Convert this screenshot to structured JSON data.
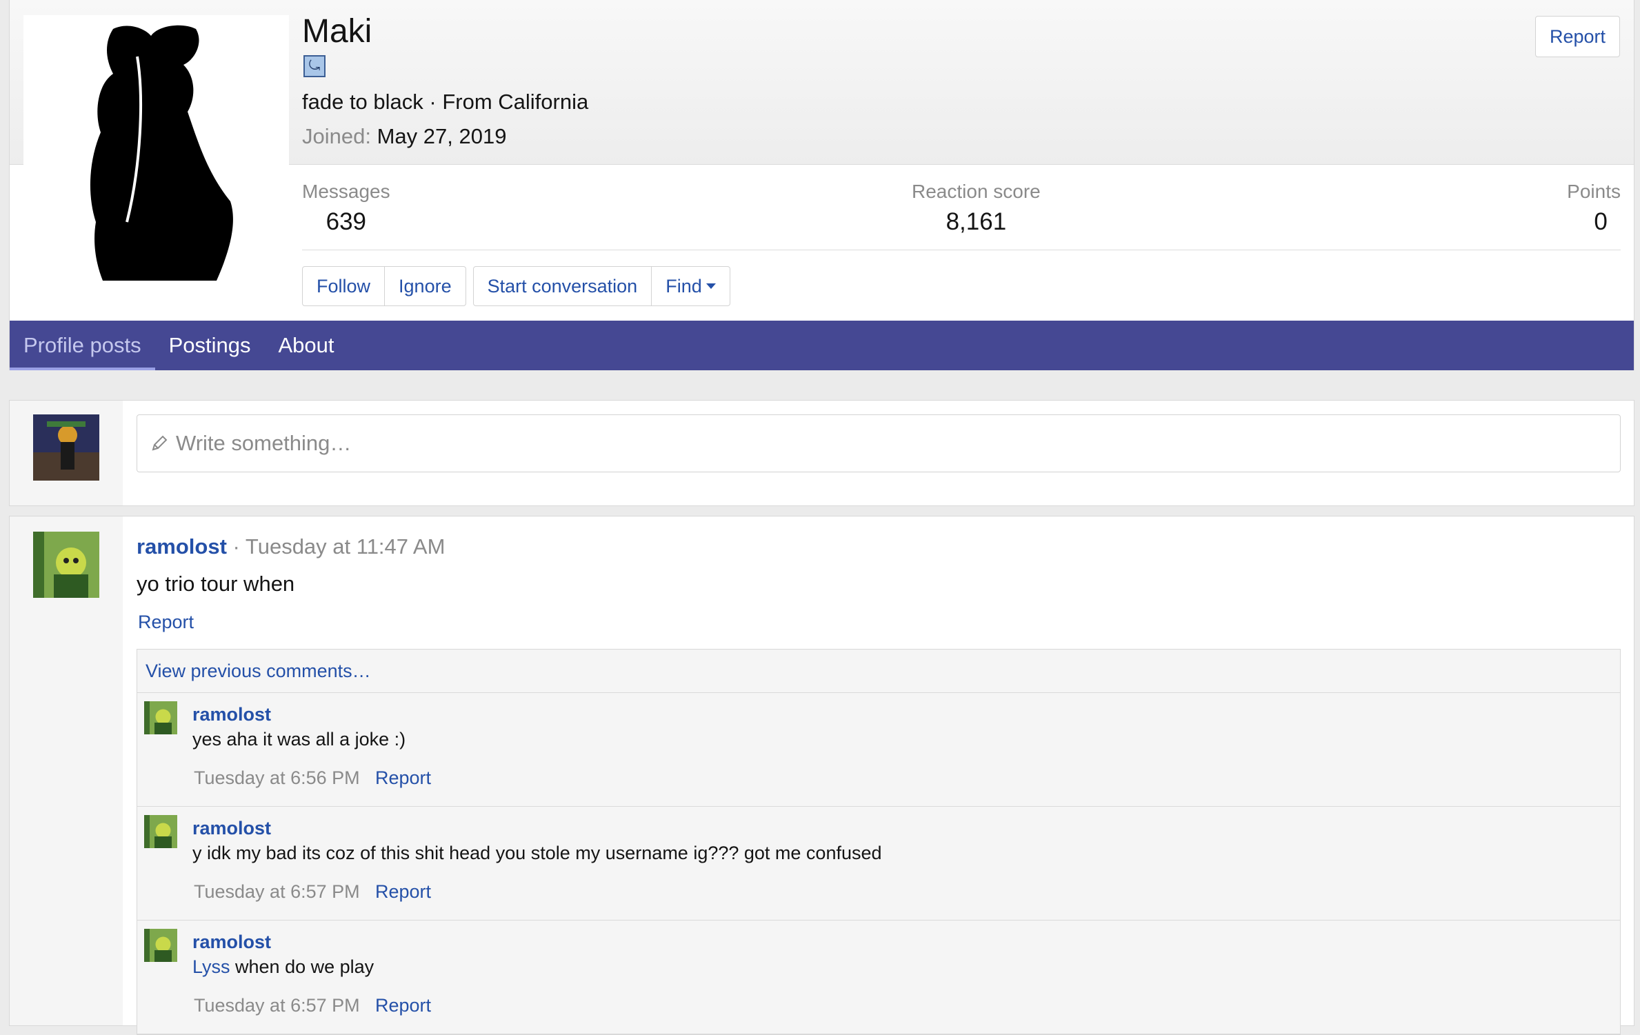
{
  "profile": {
    "username": "Maki",
    "blurb": "fade to black · From California",
    "joined_label": "Joined:",
    "joined_date": "May 27, 2019",
    "report_label": "Report",
    "stats": {
      "messages_label": "Messages",
      "messages_value": "639",
      "reaction_label": "Reaction score",
      "reaction_value": "8,161",
      "points_label": "Points",
      "points_value": "0"
    },
    "actions": {
      "follow": "Follow",
      "ignore": "Ignore",
      "start_conversation": "Start conversation",
      "find": "Find"
    }
  },
  "tabs": [
    {
      "label": "Profile posts"
    },
    {
      "label": "Postings"
    },
    {
      "label": "About"
    }
  ],
  "write": {
    "placeholder": "Write something…"
  },
  "post": {
    "author": "ramolost",
    "time": "· Tuesday at 11:47 AM",
    "text": "yo trio tour when",
    "report_label": "Report",
    "view_previous": "View previous comments…",
    "comments": [
      {
        "author": "ramolost",
        "mention": "",
        "text": "yes aha it was all a joke :)",
        "time": "Tuesday at 6:56 PM",
        "report": "Report"
      },
      {
        "author": "ramolost",
        "mention": "",
        "text": "y idk my bad its coz of this shit head you stole my username ig??? got me confused",
        "time": "Tuesday at 6:57 PM",
        "report": "Report"
      },
      {
        "author": "ramolost",
        "mention": "Lyss",
        "text": " when do we play",
        "time": "Tuesday at 6:57 PM",
        "report": "Report"
      }
    ]
  }
}
